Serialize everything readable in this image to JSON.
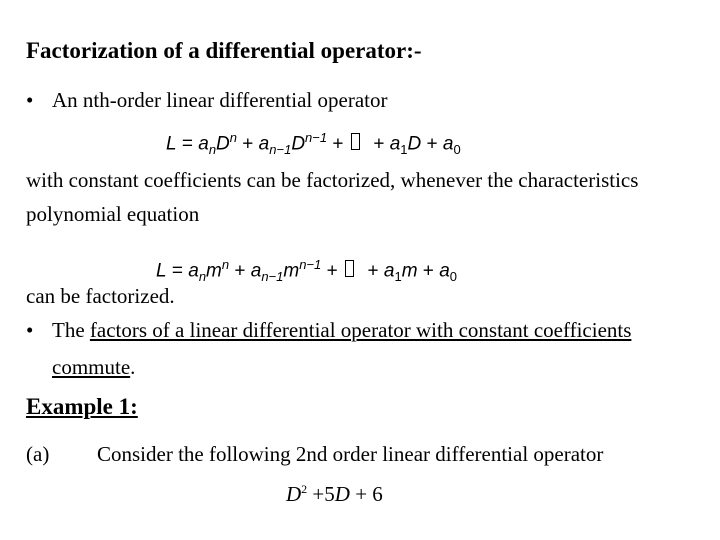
{
  "title": "Factorization of a differential operator:-",
  "bullet1": "An nth-order linear differential operator",
  "eq1": {
    "lhs": "L",
    "eq": " = ",
    "t1c": "a",
    "t1s": "n",
    "t1v": "D",
    "t1p": "n",
    "plus": " + ",
    "t2c": "a",
    "t2s": "n−1",
    "t2v": "D",
    "t2p": "n−1",
    "t3c": "a",
    "t3s": "1",
    "t3v": "D",
    "t4c": "a",
    "t4s": "0"
  },
  "para1_line1": "with constant coefficients can be factorized, whenever the characteristics",
  "para1_line2": "polynomial equation",
  "eq2": {
    "lhs": "L",
    "eq": " = ",
    "t1c": "a",
    "t1s": "n",
    "t1v": "m",
    "t1p": "n",
    "plus": " + ",
    "t2c": "a",
    "t2s": "n−1",
    "t2v": "m",
    "t2p": "n−1",
    "t3c": "a",
    "t3s": "1",
    "t3v": "m",
    "t4c": "a",
    "t4s": "0"
  },
  "para2": "can be factorized.",
  "bullet2": {
    "prefix": "The ",
    "underlined": "factors of a linear differential operator with constant coefficients",
    "line2_underlined": "commute",
    "line2_suffix": "."
  },
  "bullet_symbol": "•",
  "example_heading": "Example 1:",
  "part_a": {
    "label": "(a)",
    "text": "Consider the following 2nd order linear differential operator"
  },
  "eq3": {
    "v": "D",
    "p": "2",
    "mid": " +5",
    "v2": "D",
    "end": " + 6"
  }
}
